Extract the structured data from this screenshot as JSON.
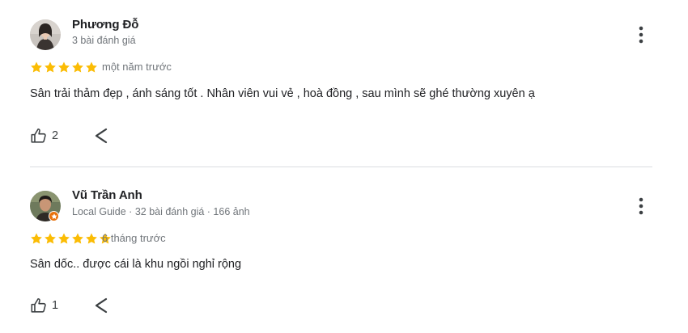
{
  "colors": {
    "star": "#fbbc04",
    "text_primary": "#202124",
    "text_secondary": "#70757a",
    "divider": "#dadce0",
    "local_guide_badge": "#e8710a"
  },
  "reviews": [
    {
      "reviewer_name": "Phương Đỗ",
      "reviewer_meta": "3 bài đánh giá",
      "avatar_icon": "reviewer-avatar-photo",
      "rating": 5,
      "time": "một năm trước",
      "text": "Sân trải thảm đẹp , ánh sáng tốt . Nhân viên vui vẻ , hoà đồng , sau mình sẽ ghé thường xuyên ạ",
      "likes": "2",
      "like_icon": "thumb-up-icon",
      "share_icon": "share-icon",
      "more_icon": "more-vert-icon"
    },
    {
      "reviewer_name": "Vũ Trần Anh",
      "reviewer_meta": "Local Guide · 32 bài đánh giá · 166 ảnh",
      "avatar_icon": "reviewer-avatar-photo",
      "local_guide_icon": "local-guide-badge-icon",
      "rating": 5,
      "time": "6 tháng trước",
      "text": "Sân dốc.. được cái là khu ngồi nghỉ rộng",
      "likes": "1",
      "like_icon": "thumb-up-icon",
      "share_icon": "share-icon",
      "more_icon": "more-vert-icon"
    }
  ]
}
